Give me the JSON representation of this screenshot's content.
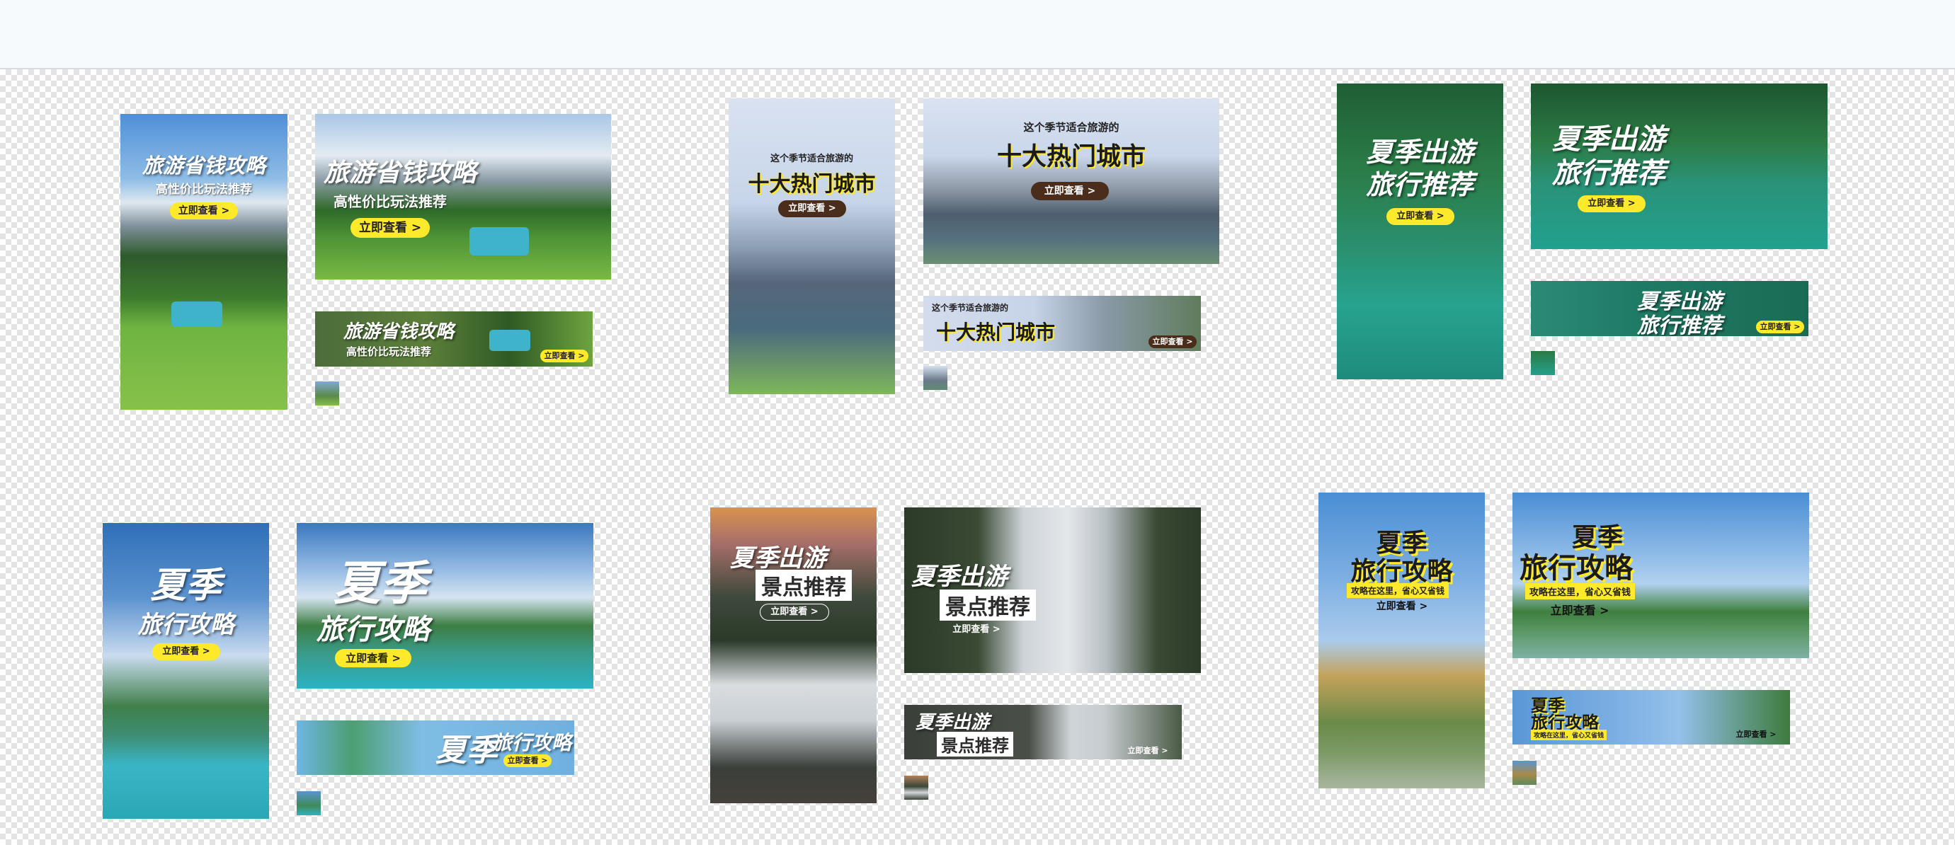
{
  "sets": {
    "s1": {
      "title": "旅游省钱攻略",
      "sub": "高性价比玩法推荐",
      "cta": "立即查看 >"
    },
    "s2": {
      "pre": "这个季节适合旅游的",
      "title": "十大热门城市",
      "cta": "立即查看 >"
    },
    "s3": {
      "l1": "夏季出游",
      "l2": "旅行推荐",
      "cta": "立即查看 >"
    },
    "s4": {
      "l1": "夏季",
      "l2": "旅行攻略",
      "cta": "立即查看 >"
    },
    "s5": {
      "l1": "夏季出游",
      "l2": "景点推荐",
      "cta": "立即查看 >"
    },
    "s6": {
      "l1": "夏季",
      "l2": "旅行攻略",
      "sub": "攻略在这里，省心又省钱",
      "cta": "立即查看 >"
    }
  }
}
